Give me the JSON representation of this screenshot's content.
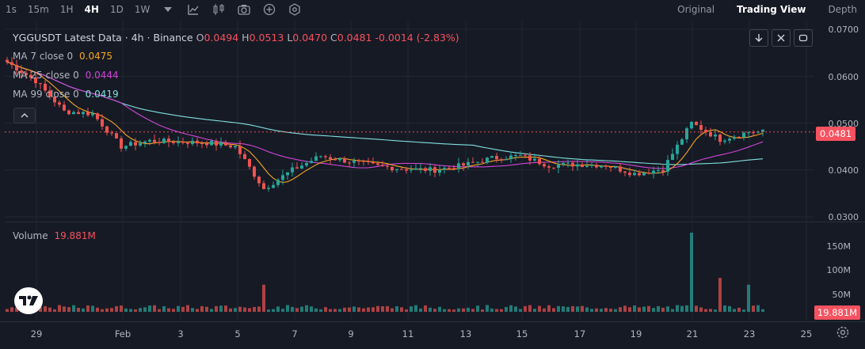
{
  "toolbar": {
    "timeframes": [
      "1s",
      "15m",
      "1H",
      "4H",
      "1D",
      "1W"
    ],
    "active_timeframe": "4H",
    "views": [
      "Original",
      "Trading View",
      "Depth"
    ],
    "active_view": "Trading View"
  },
  "legend": {
    "title": "YGGUSDT Latest Data · 4h · Binance",
    "o_label": "O",
    "o": "0.0494",
    "h_label": "H",
    "h": "0.0513",
    "l_label": "L",
    "l": "0.0470",
    "c_label": "C",
    "c": "0.0481",
    "change": "-0.0014 (-2.83%)"
  },
  "ma": [
    {
      "label": "MA 7 close 0",
      "value": "0.0475",
      "color": "#f5a623"
    },
    {
      "label": "MA 25 close 0",
      "value": "0.0444",
      "color": "#d046d6"
    },
    {
      "label": "MA 99 close 0",
      "value": "0.0419",
      "color": "#7fe0e0"
    }
  ],
  "price_axis": [
    "0.0700",
    "0.0600",
    "0.0500",
    "0.0400",
    "0.0300"
  ],
  "current_price": "0.0481",
  "volume": {
    "label": "Volume",
    "value": "19.881M",
    "axis": [
      "150M",
      "100M",
      "50M"
    ],
    "current": "19.881M"
  },
  "time_axis": [
    "29",
    "Feb",
    "3",
    "5",
    "7",
    "9",
    "11",
    "13",
    "15",
    "17",
    "19",
    "21",
    "23",
    "25"
  ],
  "colors": {
    "up": "#26a69a",
    "down": "#ef5350",
    "background": "#161a25",
    "grid": "#232733"
  },
  "chart_data": {
    "type": "candlestick",
    "title": "YGGUSDT Latest Data · 4h · Binance",
    "x_range": [
      "Jan 28",
      "Feb 24"
    ],
    "ylim": [
      0.03,
      0.07
    ],
    "y_ticks": [
      0.07,
      0.06,
      0.05,
      0.04,
      0.03
    ],
    "close_path": [
      {
        "date": "Jan 28",
        "close": 0.063
      },
      {
        "date": "Jan 29",
        "close": 0.059
      },
      {
        "date": "Jan 30",
        "close": 0.0525
      },
      {
        "date": "Jan 31",
        "close": 0.052
      },
      {
        "date": "Feb 1",
        "close": 0.045
      },
      {
        "date": "Feb 2",
        "close": 0.0462
      },
      {
        "date": "Feb 3",
        "close": 0.046
      },
      {
        "date": "Feb 4",
        "close": 0.0458
      },
      {
        "date": "Feb 5",
        "close": 0.045
      },
      {
        "date": "Feb 6",
        "close": 0.036
      },
      {
        "date": "Feb 7",
        "close": 0.04
      },
      {
        "date": "Feb 8",
        "close": 0.043
      },
      {
        "date": "Feb 9",
        "close": 0.0418
      },
      {
        "date": "Feb 10",
        "close": 0.0408
      },
      {
        "date": "Feb 11",
        "close": 0.0402
      },
      {
        "date": "Feb 12",
        "close": 0.04
      },
      {
        "date": "Feb 13",
        "close": 0.041
      },
      {
        "date": "Feb 14",
        "close": 0.0425
      },
      {
        "date": "Feb 15",
        "close": 0.043
      },
      {
        "date": "Feb 16",
        "close": 0.041
      },
      {
        "date": "Feb 17",
        "close": 0.0412
      },
      {
        "date": "Feb 18",
        "close": 0.041
      },
      {
        "date": "Feb 19",
        "close": 0.0392
      },
      {
        "date": "Feb 20",
        "close": 0.0402
      },
      {
        "date": "Feb 21",
        "close": 0.05
      },
      {
        "date": "Feb 22",
        "close": 0.0465
      },
      {
        "date": "Feb 23",
        "close": 0.0481
      }
    ],
    "volume_spikes": [
      {
        "date": "Feb 6",
        "volume_m": 60
      },
      {
        "date": "Feb 21",
        "volume_m": 175
      },
      {
        "date": "Feb 22",
        "volume_m": 75
      },
      {
        "date": "Feb 23",
        "volume_m": 60
      }
    ]
  }
}
